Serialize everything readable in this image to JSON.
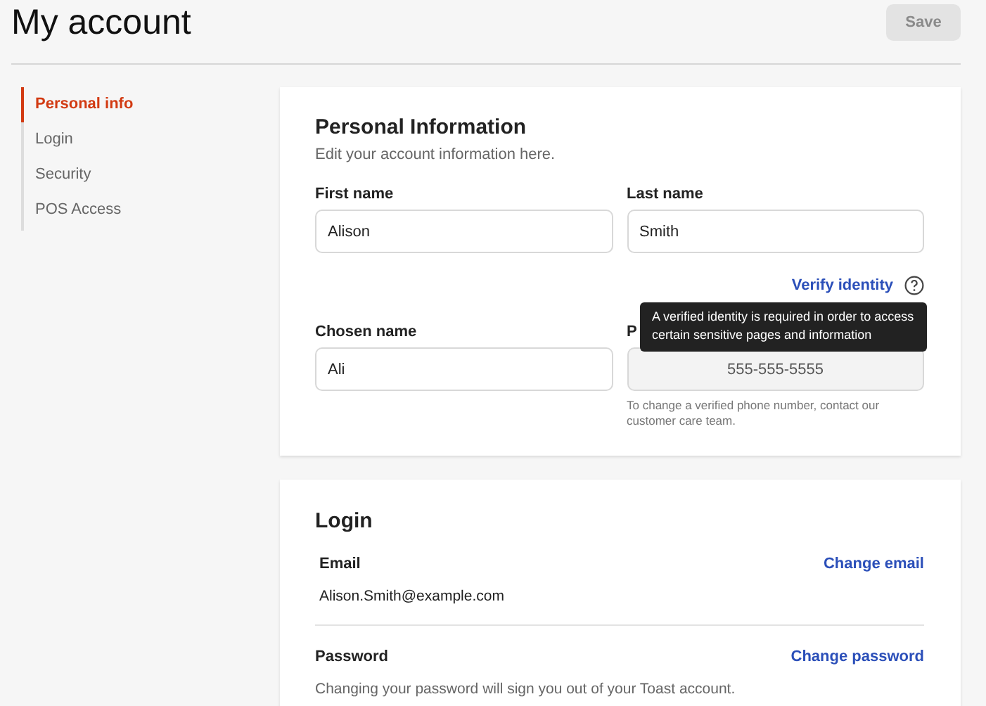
{
  "page": {
    "title": "My account"
  },
  "save_button": {
    "label": "Save",
    "disabled": true
  },
  "sidebar": {
    "items": [
      {
        "label": "Personal info",
        "selected": true
      },
      {
        "label": "Login",
        "selected": false
      },
      {
        "label": "Security",
        "selected": false
      },
      {
        "label": "POS Access",
        "selected": false
      }
    ]
  },
  "personal_information": {
    "title": "Personal Information",
    "subtitle": "Edit your account information here.",
    "first_name": {
      "label": "First name",
      "value": "Alison"
    },
    "last_name": {
      "label": "Last name",
      "value": "Smith"
    },
    "verify_link": "Verify identity",
    "tooltip": "A verified identity is required in order to access certain sensitive pages and information",
    "chosen_name": {
      "label": "Chosen name",
      "value": "Ali"
    },
    "phone": {
      "label": "P",
      "value": "555-555-5555",
      "disabled": true,
      "help": "To change a verified phone number, contact our customer care team."
    }
  },
  "login": {
    "title": "Login",
    "email": {
      "label": "Email",
      "value": "Alison.Smith@example.com",
      "action": "Change email"
    },
    "password": {
      "label": "Password",
      "note": "Changing your password will sign you out of your Toast account.",
      "action": "Change password"
    }
  }
}
